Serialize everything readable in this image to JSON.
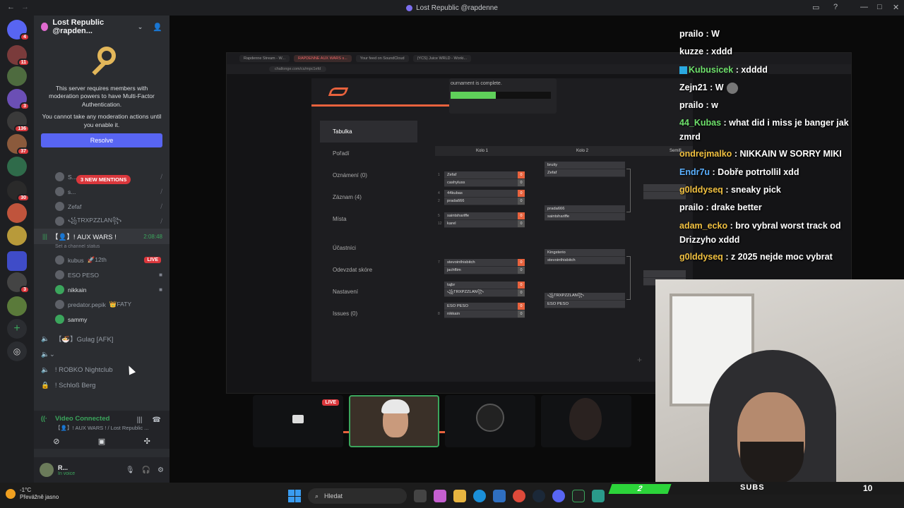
{
  "window": {
    "title": "Lost Republic @rapdenne",
    "back_icon": "←",
    "forward_icon": "→"
  },
  "servers": {
    "badges": [
      "4",
      "11",
      "3",
      "136",
      "37",
      "30",
      "3"
    ]
  },
  "server_header": {
    "name": "Lost Republic @rapden...",
    "chevron": "⌄",
    "invite_icon": "person-add"
  },
  "mfa_notice": {
    "line1": "This server requires members with moderation powers to have Multi-Factor Authentication.",
    "line2": "You cannot take any moderation actions until you enable it.",
    "button": "Resolve"
  },
  "mention_pill": "3 NEW MENTIONS",
  "voice_members_top": [
    {
      "name": "S..."
    },
    {
      "name": "s..."
    },
    {
      "name": "Zefaf"
    },
    {
      "name": "꧁TRXPZZLAN꧂"
    }
  ],
  "active_channel": {
    "name": "【👤】! AUX WARS !",
    "duration": "2:08:48",
    "status": "Set a channel status"
  },
  "voice_members": [
    {
      "name": "kubus",
      "tag": "🚀12th",
      "live": "LIVE"
    },
    {
      "name": "ESO PESO",
      "tag": ""
    },
    {
      "name": "nikkain",
      "tag": ""
    },
    {
      "name": "predator.pepik",
      "tag": "👑FATY"
    },
    {
      "name": "sammy",
      "tag": ""
    }
  ],
  "other_channels": [
    {
      "name": "【🍜】Gulag [AFK]"
    },
    {
      "name": ""
    },
    {
      "name": "! ROBKO Nightclub"
    },
    {
      "name": "! Schloß Berg"
    }
  ],
  "voice_connection": {
    "status": "Video Connected",
    "channel": "【👤】! AUX WARS ! / Lost Republic ..."
  },
  "user": {
    "name": "R...",
    "status": "In voice"
  },
  "browser": {
    "tabs": [
      "Rapdenne Stream - W...",
      "RAPDENNE AUX WARS s...",
      "Your feed on SoundCloud",
      "(YCS) Juice WRLD - Worki..."
    ],
    "url": "challonge.com/cs/mpc1efd"
  },
  "challonge": {
    "menu": [
      "Tabulka",
      "Pořadí",
      "Oznámení (0)",
      "Záznam (4)",
      "Místa",
      "Účastníci",
      "Odevzdat skóre",
      "Nastavení",
      "Issues (0)"
    ],
    "progress_text": "ournament is complete.",
    "progress_fraction": 0.45,
    "rounds": [
      "Kolo 1",
      "Kolo 2",
      "Semifi..."
    ],
    "round1": [
      {
        "seed_a": "1",
        "a": "Zefaf",
        "sa": "0",
        "seed_b": "",
        "b": "cashyluss",
        "sb": "0"
      },
      {
        "seed_a": "4",
        "a": "44kubas",
        "sa": "0",
        "seed_b": "2",
        "b": "prada666",
        "sb": "0"
      },
      {
        "seed_a": "5",
        "a": "saintshariffe",
        "sa": "0",
        "seed_b": "12",
        "b": "karel",
        "sb": "0"
      },
      {
        "seed_a": "7",
        "a": "stevointhisbitch",
        "sa": "0",
        "seed_b": "",
        "b": "jachflim",
        "sb": "0"
      },
      {
        "seed_a": "",
        "a": "tajbr",
        "sa": "0",
        "seed_b": "",
        "b": "꧁TRXPZZLAN꧂",
        "sb": "0"
      },
      {
        "seed_a": "",
        "a": "ESO PESO",
        "sa": "0",
        "seed_b": "8",
        "b": "nikkain",
        "sb": "0"
      }
    ],
    "round2": [
      {
        "a": "bruity",
        "b": "Zefaf"
      },
      {
        "a": "prada666",
        "b": "saintshariffe"
      },
      {
        "a": "Kingsterio",
        "b": "stevointhisbitch"
      },
      {
        "a": "꧁TRXPZZLAN꧂",
        "b": "ESO PESO"
      }
    ],
    "plus_icon": "+"
  },
  "chat": [
    {
      "user": "prailo",
      "msg": ": W",
      "color": "w"
    },
    {
      "user": "kuzze",
      "msg": ": xddd",
      "color": "w"
    },
    {
      "user": "Kubusicek",
      "msg": ": xdddd",
      "color": "g"
    },
    {
      "user": "Zejn21",
      "msg": ": W",
      "color": "w"
    },
    {
      "user": "prailo",
      "msg": ": w",
      "color": "w"
    },
    {
      "user": "44_Kubas",
      "msg": ": what did i miss je banger jak zmrd",
      "color": "g"
    },
    {
      "user": "ondrejmalko",
      "msg": ": NIKKAIN W SORRY MIKI",
      "color": "y"
    },
    {
      "user": "Endr7u",
      "msg": ": Dobře potrtollil xdd",
      "color": "b"
    },
    {
      "user": "g0lddyseq",
      "msg": ": sneaky pick",
      "color": "y"
    },
    {
      "user": "prailo",
      "msg": ": drake better",
      "color": "w"
    },
    {
      "user": "adam_ecko",
      "msg": ": bro vybral worst track od Drizzyho xddd",
      "color": "y"
    },
    {
      "user": "g0lddyseq",
      "msg": ": z 2025 nejde moc vybrat",
      "color": "y"
    }
  ],
  "tiles": [
    {
      "kind": "screen",
      "live": "LIVE"
    },
    {
      "kind": "face",
      "live": ""
    },
    {
      "kind": "disc",
      "live": ""
    },
    {
      "kind": "dark",
      "live": ""
    }
  ],
  "subs_overlay": {
    "left": "2",
    "label": "SUBS",
    "right": "10"
  },
  "taskbar": {
    "temp": "-1°C",
    "weather": "Převážně jasno",
    "search_placeholder": "Hledat"
  }
}
